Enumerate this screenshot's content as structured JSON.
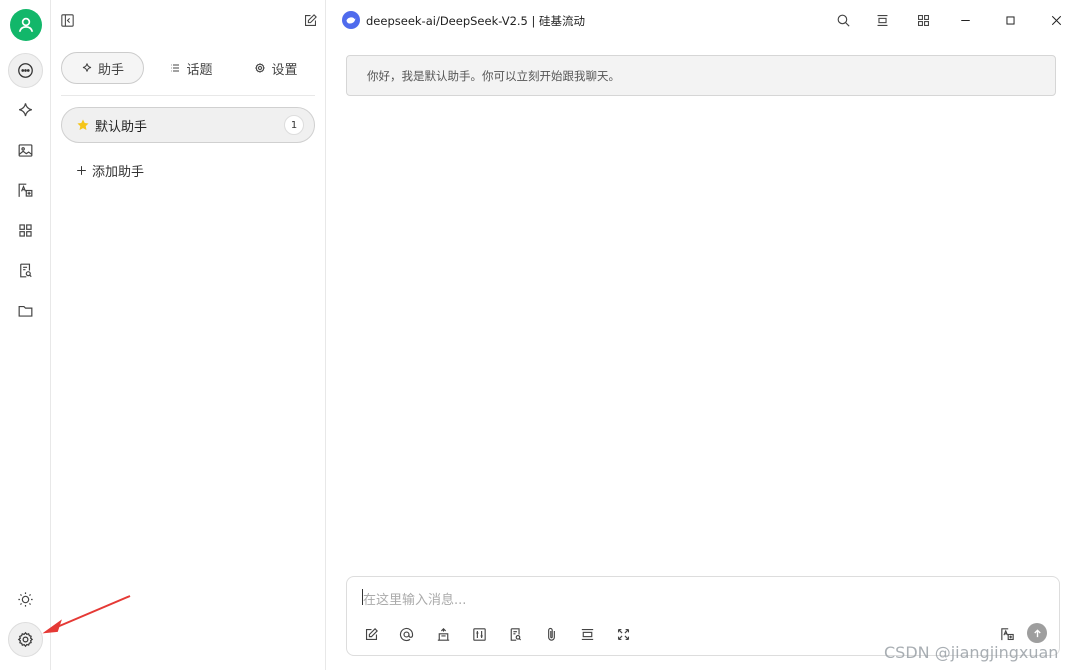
{
  "topbar": {
    "model_title": "deepseek-ai/DeepSeek-V2.5 | 硅基流动"
  },
  "sidebar": {
    "tabs": [
      {
        "label": "助手"
      },
      {
        "label": "话题"
      },
      {
        "label": "设置"
      }
    ],
    "assistant": {
      "name": "默认助手",
      "count": "1"
    },
    "add_label": "添加助手"
  },
  "chat": {
    "greeting": "你好，我是默认助手。你可以立刻开始跟我聊天。"
  },
  "composer": {
    "placeholder": "在这里输入消息..."
  },
  "watermark": "CSDN @jiangjingxuan",
  "colors": {
    "avatar": "#12b76a",
    "model_badge": "#4f6bed",
    "star": "#f5c518",
    "annotation_arrow": "#e53935"
  },
  "icons": {
    "rail": [
      "chat-icon",
      "sparkle-icon",
      "image-icon",
      "translate-icon",
      "apps-icon",
      "document-search-icon",
      "folder-icon",
      "sun-icon",
      "gear-icon"
    ],
    "topbar": [
      "sidebar-toggle-icon",
      "edit-icon",
      "search-icon",
      "fit-icon",
      "grid-icon",
      "minimize-icon",
      "maximize-icon",
      "close-icon"
    ],
    "composer": [
      "edit-icon",
      "at-icon",
      "knowledge-icon",
      "sliders-icon",
      "document-search-icon",
      "paperclip-icon",
      "layout-icon",
      "expand-icon",
      "translate-icon",
      "send-icon"
    ]
  }
}
